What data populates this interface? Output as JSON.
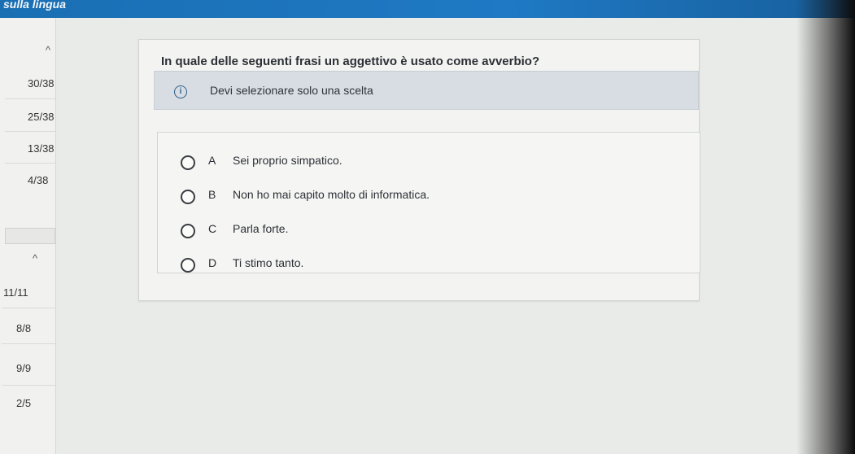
{
  "header": {
    "title": "sulla lingua"
  },
  "sidebar": {
    "group1_scores": [
      "30/38",
      "25/38",
      "13/38",
      "4/38"
    ],
    "group2_scores": [
      "11/11",
      "8/8",
      "9/9",
      "2/5"
    ]
  },
  "question": {
    "text": "In quale delle seguenti frasi un aggettivo è usato come avverbio?",
    "info": "Devi selezionare solo una scelta",
    "options": [
      {
        "letter": "A",
        "text": "Sei proprio simpatico."
      },
      {
        "letter": "B",
        "text": "Non ho mai capito molto di informatica."
      },
      {
        "letter": "C",
        "text": "Parla forte."
      },
      {
        "letter": "D",
        "text": "Ti stimo tanto."
      }
    ]
  },
  "colors": {
    "topbar": "#1f79c4",
    "info_bar": "#d7dde2",
    "page_bg": "#e9ebe8"
  },
  "icons": {
    "chevron": "chevron-up-icon",
    "info": "info-icon"
  }
}
